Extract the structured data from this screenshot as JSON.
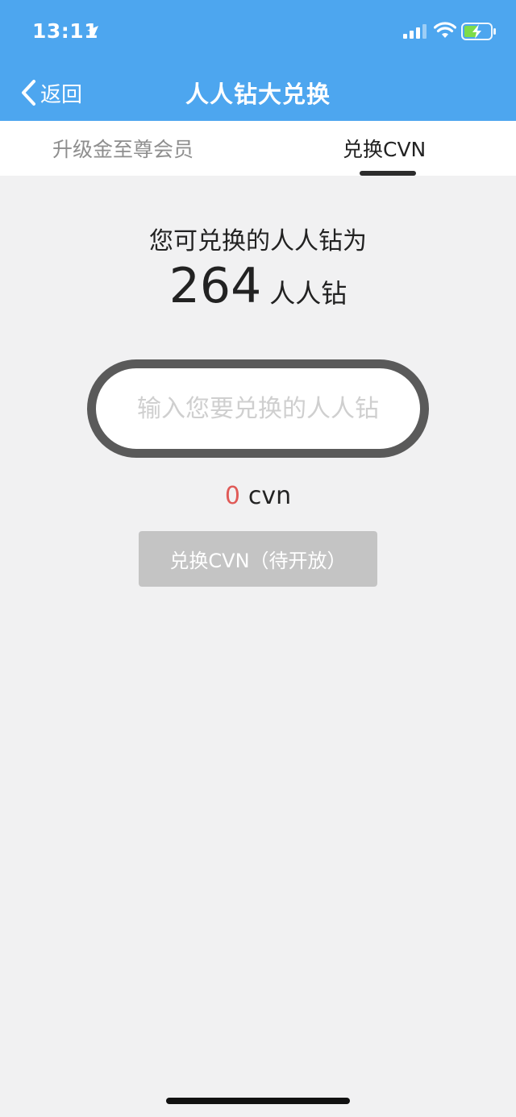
{
  "status_bar": {
    "time": "13:11",
    "icons": [
      "location-arrow-icon",
      "signal-icon",
      "wifi-icon",
      "battery-charging-icon"
    ]
  },
  "nav": {
    "back_label": "返回",
    "title": "人人钻大兑换"
  },
  "tabs": [
    {
      "label": "升级金至尊会员",
      "active": false
    },
    {
      "label": "兑换CVN",
      "active": true
    }
  ],
  "exchange": {
    "balance_label": "您可兑换的人人钻为",
    "balance_value": "264",
    "balance_unit": "人人钻",
    "input_placeholder": "输入您要兑换的人人钻",
    "input_value": "",
    "cvn_value": "0",
    "cvn_unit": "cvn",
    "button_label": "兑换CVN（待开放）"
  },
  "colors": {
    "header_bg": "#4da6ef",
    "page_bg": "#f1f1f2",
    "cvn_value": "#e05a57",
    "button_disabled": "#c4c4c4"
  }
}
